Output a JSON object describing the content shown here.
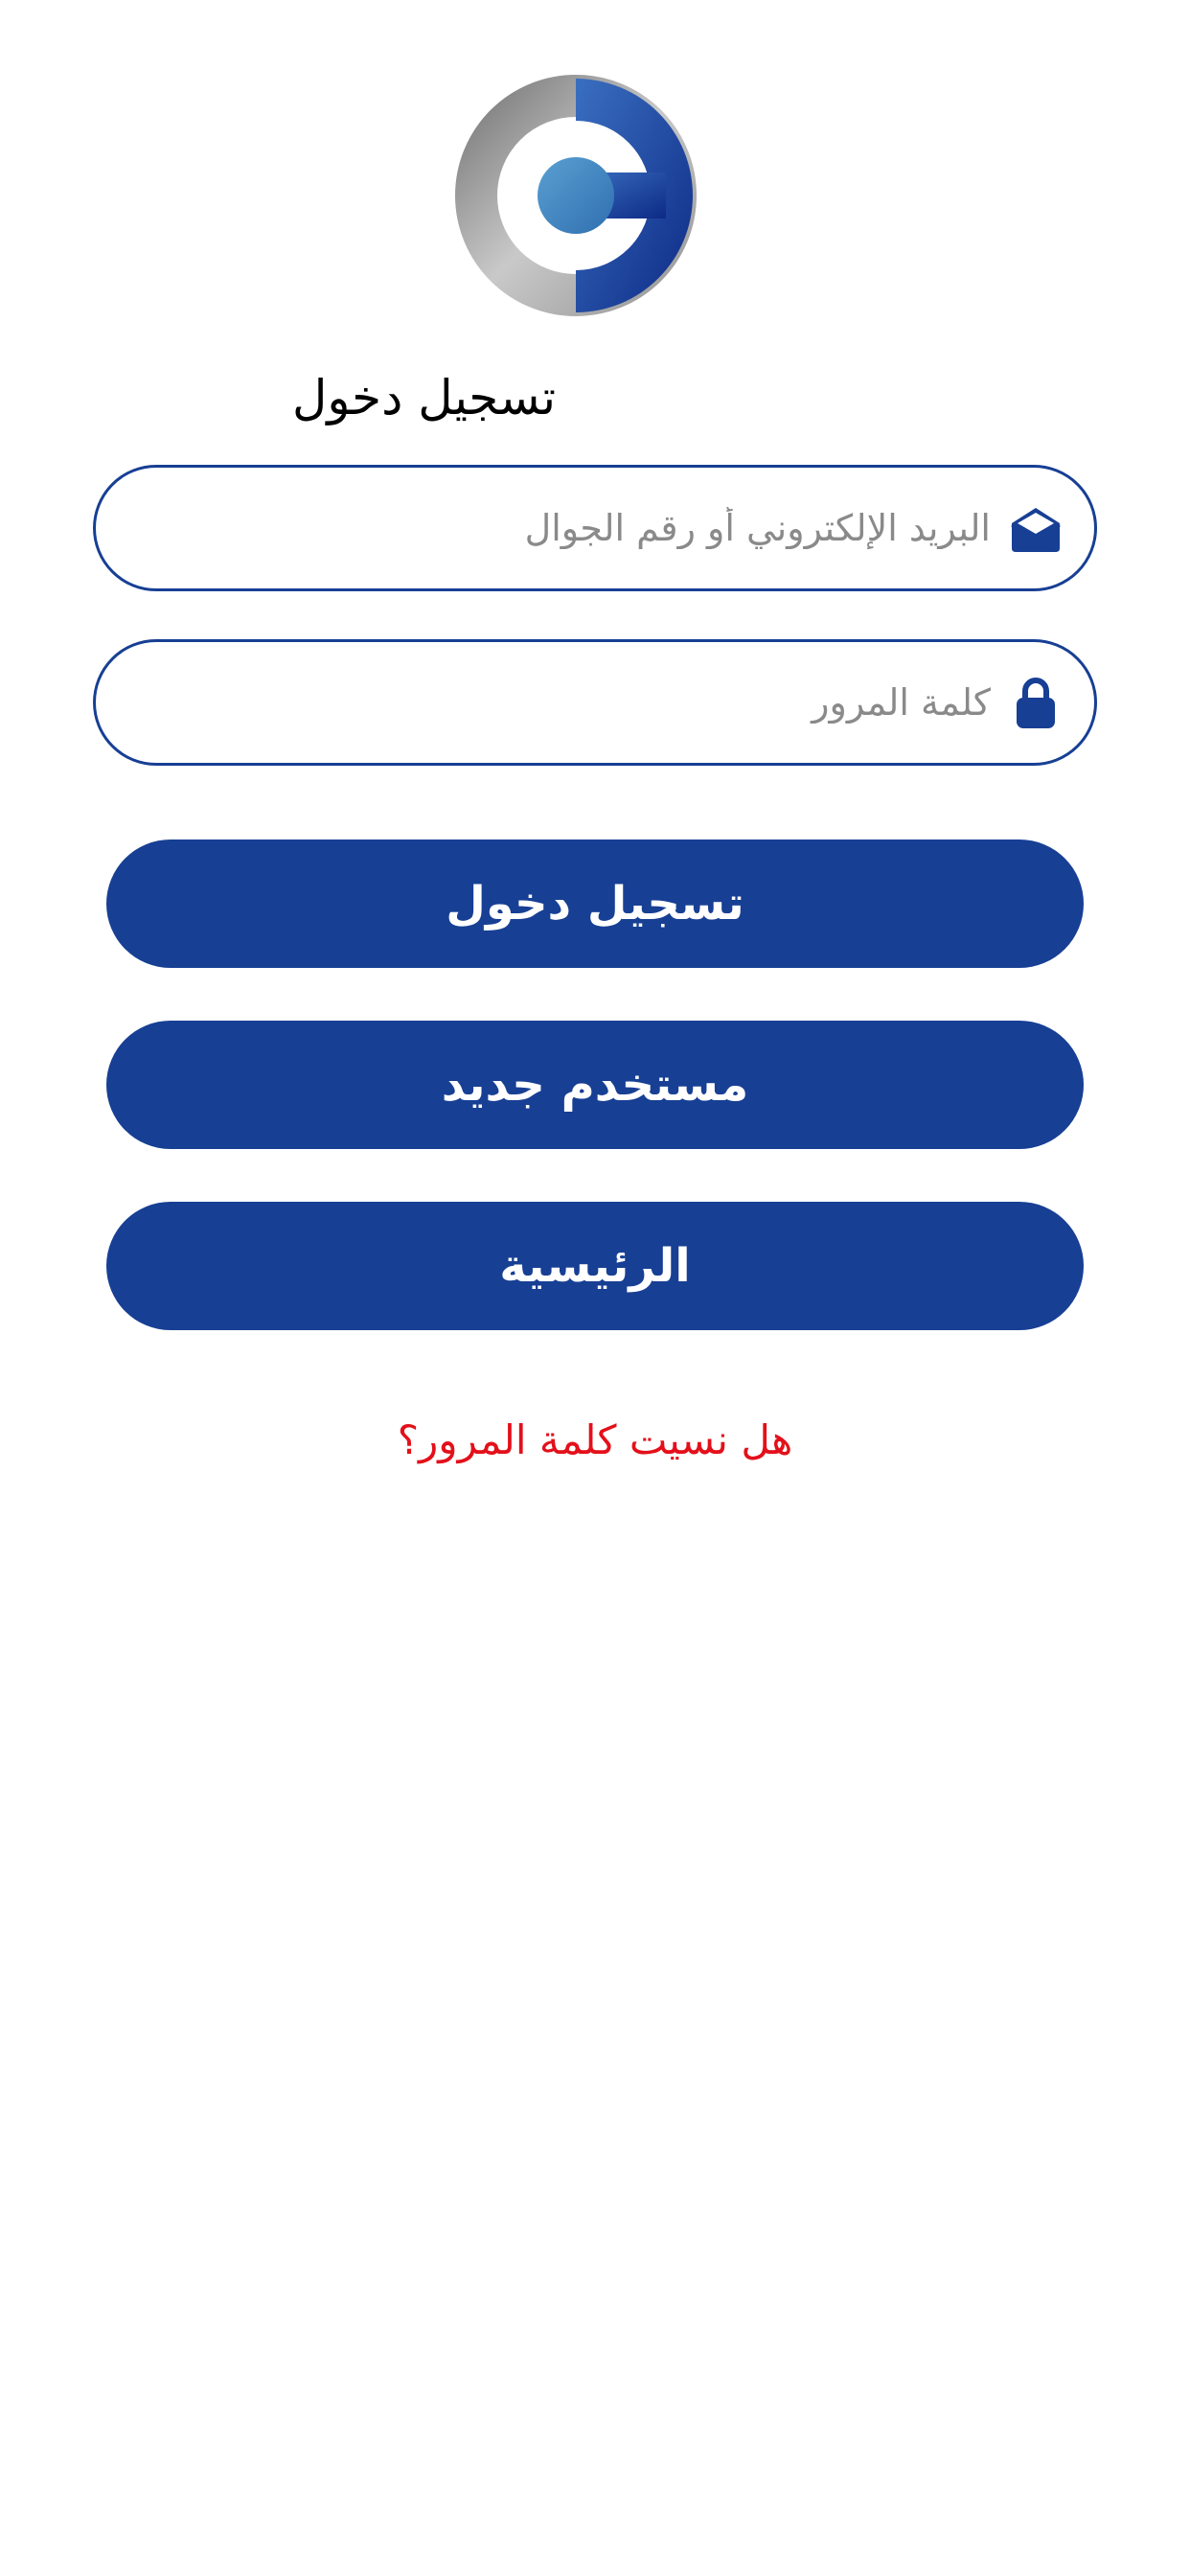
{
  "app": {
    "logo_icon": "e-logo-icon"
  },
  "login": {
    "title": "تسجيل دخول",
    "email_field": {
      "placeholder": "البريد الإلكتروني أو رقم الجوال",
      "value": "",
      "icon": "envelope-open-icon"
    },
    "password_field": {
      "placeholder": "كلمة المرور",
      "value": "",
      "icon": "lock-icon"
    },
    "login_button": "تسجيل دخول",
    "register_button": "مستخدم جديد",
    "home_button": "الرئيسية",
    "forgot_password_link": "هل نسيت كلمة المرور؟"
  },
  "colors": {
    "primary": "#173f94",
    "link": "#e3101a",
    "background": "#ffffff"
  }
}
